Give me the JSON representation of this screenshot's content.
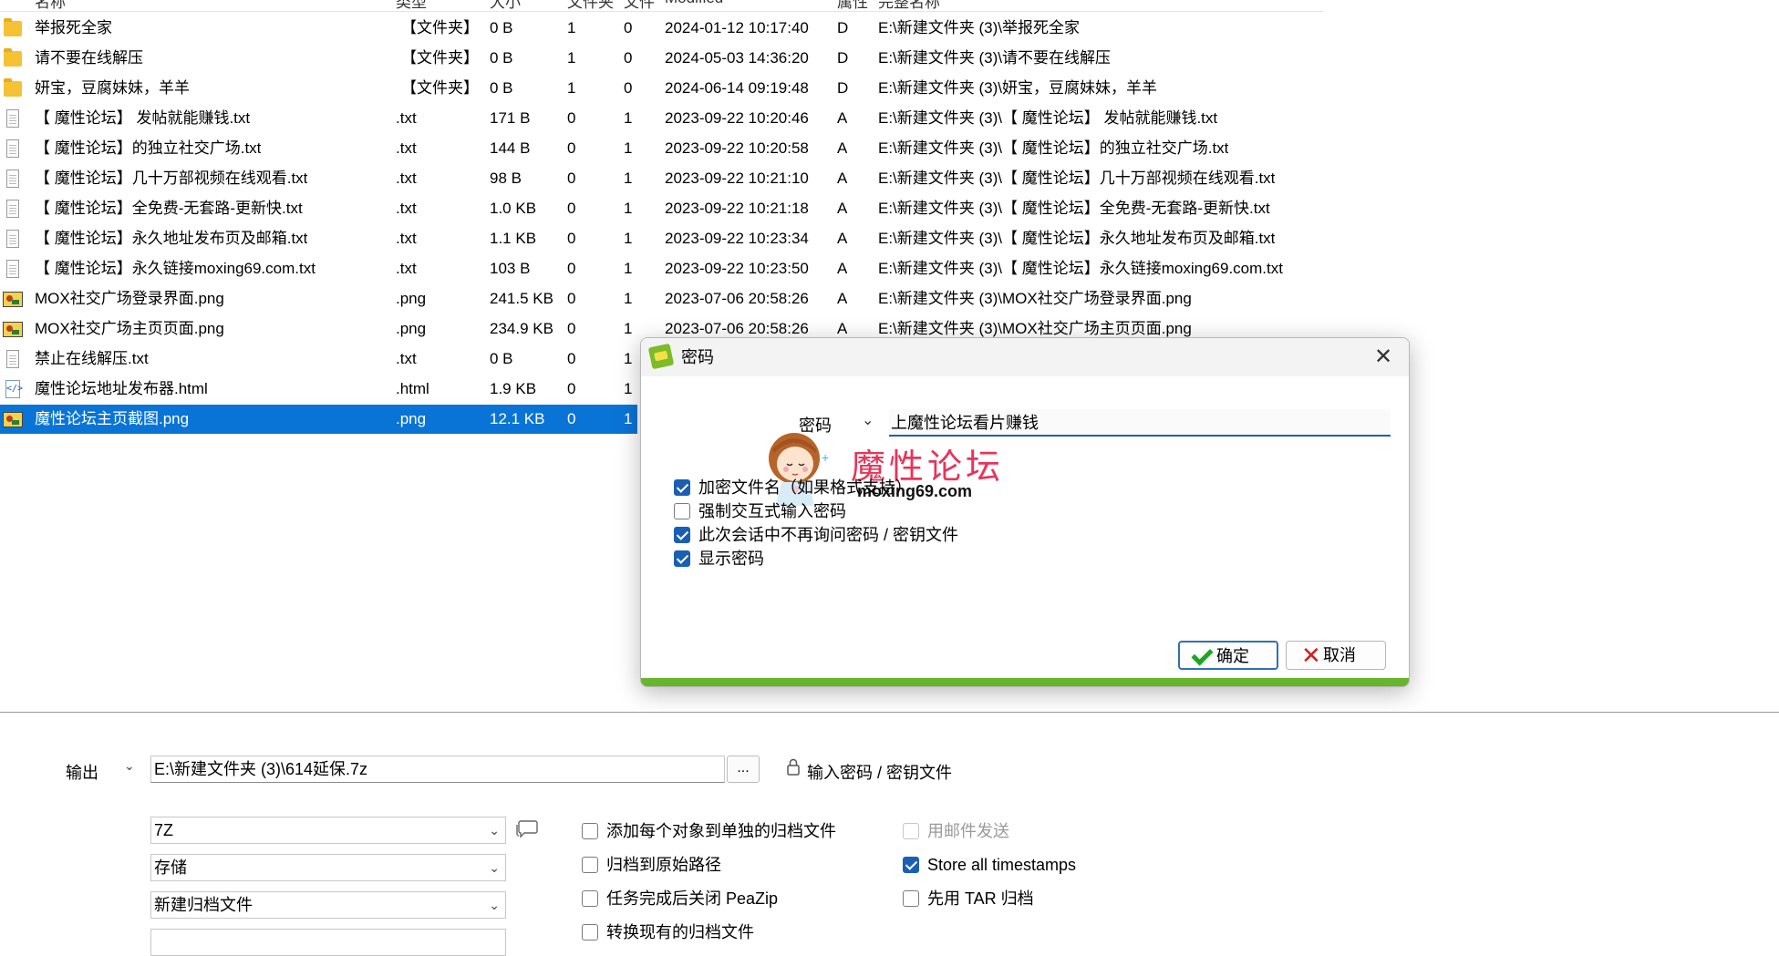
{
  "columns": {
    "name": "名称",
    "type": "类型",
    "size": "大小",
    "folders": "文件夹",
    "files": "文件",
    "modified": "Modified",
    "attr": "属性",
    "original": "完整名称"
  },
  "files": [
    {
      "name": "举报死全家",
      "type": "【文件夹】",
      "size": "0 B",
      "folders": "1",
      "files": "0",
      "modified": "2024-01-12 10:17:40",
      "attr": "D",
      "path": "E:\\新建文件夹 (3)\\举报死全家",
      "icon": "folder-icon"
    },
    {
      "name": "请不要在线解压",
      "type": "【文件夹】",
      "size": "0 B",
      "folders": "1",
      "files": "0",
      "modified": "2024-05-03 14:36:20",
      "attr": "D",
      "path": "E:\\新建文件夹 (3)\\请不要在线解压",
      "icon": "folder-icon"
    },
    {
      "name": "妍宝，豆腐妹妹，羊羊",
      "type": "【文件夹】",
      "size": "0 B",
      "folders": "1",
      "files": "0",
      "modified": "2024-06-14 09:19:48",
      "attr": "D",
      "path": "E:\\新建文件夹 (3)\\妍宝，豆腐妹妹，羊羊",
      "icon": "folder-icon"
    },
    {
      "name": "【 魔性论坛】 发帖就能赚钱.txt",
      "type": ".txt",
      "size": "171 B",
      "folders": "0",
      "files": "1",
      "modified": "2023-09-22 10:20:46",
      "attr": "A",
      "path": "E:\\新建文件夹 (3)\\【 魔性论坛】 发帖就能赚钱.txt",
      "icon": "text-file-icon"
    },
    {
      "name": "【 魔性论坛】的独立社交广场.txt",
      "type": ".txt",
      "size": "144 B",
      "folders": "0",
      "files": "1",
      "modified": "2023-09-22 10:20:58",
      "attr": "A",
      "path": "E:\\新建文件夹 (3)\\【 魔性论坛】的独立社交广场.txt",
      "icon": "text-file-icon"
    },
    {
      "name": "【 魔性论坛】几十万部视频在线观看.txt",
      "type": ".txt",
      "size": "98 B",
      "folders": "0",
      "files": "1",
      "modified": "2023-09-22 10:21:10",
      "attr": "A",
      "path": "E:\\新建文件夹 (3)\\【 魔性论坛】几十万部视频在线观看.txt",
      "icon": "text-file-icon"
    },
    {
      "name": "【 魔性论坛】全免费-无套路-更新快.txt",
      "type": ".txt",
      "size": "1.0 KB",
      "folders": "0",
      "files": "1",
      "modified": "2023-09-22 10:21:18",
      "attr": "A",
      "path": "E:\\新建文件夹 (3)\\【 魔性论坛】全免费-无套路-更新快.txt",
      "icon": "text-file-icon"
    },
    {
      "name": "【 魔性论坛】永久地址发布页及邮箱.txt",
      "type": ".txt",
      "size": "1.1 KB",
      "folders": "0",
      "files": "1",
      "modified": "2023-09-22 10:23:34",
      "attr": "A",
      "path": "E:\\新建文件夹 (3)\\【 魔性论坛】永久地址发布页及邮箱.txt",
      "icon": "text-file-icon"
    },
    {
      "name": "【 魔性论坛】永久链接moxing69.com.txt",
      "type": ".txt",
      "size": "103 B",
      "folders": "0",
      "files": "1",
      "modified": "2023-09-22 10:23:50",
      "attr": "A",
      "path": "E:\\新建文件夹 (3)\\【 魔性论坛】永久链接moxing69.com.txt",
      "icon": "text-file-icon"
    },
    {
      "name": "MOX社交广场登录界面.png",
      "type": ".png",
      "size": "241.5 KB",
      "folders": "0",
      "files": "1",
      "modified": "2023-07-06 20:58:26",
      "attr": "A",
      "path": "E:\\新建文件夹 (3)\\MOX社交广场登录界面.png",
      "icon": "image-file-icon"
    },
    {
      "name": "MOX社交广场主页页面.png",
      "type": ".png",
      "size": "234.9 KB",
      "folders": "0",
      "files": "1",
      "modified": "2023-07-06 20:58:26",
      "attr": "A",
      "path": "E:\\新建文件夹 (3)\\MOX社交广场主页页面.png",
      "icon": "image-file-icon"
    },
    {
      "name": "禁止在线解压.txt",
      "type": ".txt",
      "size": "0 B",
      "folders": "0",
      "files": "1",
      "modified": "",
      "attr": "",
      "path": "",
      "icon": "text-file-icon"
    },
    {
      "name": "魔性论坛地址发布器.html",
      "type": ".html",
      "size": "1.9 KB",
      "folders": "0",
      "files": "1",
      "modified": "",
      "attr": "",
      "path": "",
      "icon": "html-file-icon"
    },
    {
      "name": "魔性论坛主页截图.png",
      "type": ".png",
      "size": "12.1 KB",
      "folders": "0",
      "files": "1",
      "modified": "",
      "attr": "",
      "path": "",
      "icon": "image-file-icon",
      "selected": true
    }
  ],
  "dialog": {
    "title": "密码",
    "close": "✕",
    "password_label": "密码",
    "password_value": "上魔性论坛看片赚钱",
    "logo_title": "魔性论坛",
    "logo_url": "moxing69.com",
    "options": [
      {
        "label": "加密文件名（如果格式支持）",
        "checked": true
      },
      {
        "label": "强制交互式输入密码",
        "checked": false
      },
      {
        "label": "此次会话中不再询问密码 / 密钥文件",
        "checked": true
      },
      {
        "label": "显示密码",
        "checked": true
      }
    ],
    "ok_label": "确定",
    "cancel_label": "取消"
  },
  "bottom": {
    "output_label": "输出",
    "output_path": "E:\\新建文件夹 (3)\\614延保.7z",
    "browse_label": "...",
    "password_link": "输入密码 / 密钥文件",
    "format": "7Z",
    "level": "存储",
    "mode": "新建归档文件",
    "options_left": [
      {
        "label": "添加每个对象到单独的归档文件",
        "checked": false
      },
      {
        "label": "归档到原始路径",
        "checked": false
      },
      {
        "label": "任务完成后关闭 PeaZip",
        "checked": false
      },
      {
        "label": "转换现有的归档文件",
        "checked": false
      }
    ],
    "options_right": [
      {
        "label": "用邮件发送",
        "checked": false,
        "disabled": true
      },
      {
        "label": "Store all timestamps",
        "checked": true,
        "disabled": false
      },
      {
        "label": "先用 TAR 归档",
        "checked": false,
        "disabled": false
      }
    ]
  },
  "colors": {
    "selection": "#0a74d6",
    "dialog_bottom_bar": "#67b52c",
    "logo_title": "#e8345a",
    "checkbox_checked": "#1a5fb4"
  }
}
